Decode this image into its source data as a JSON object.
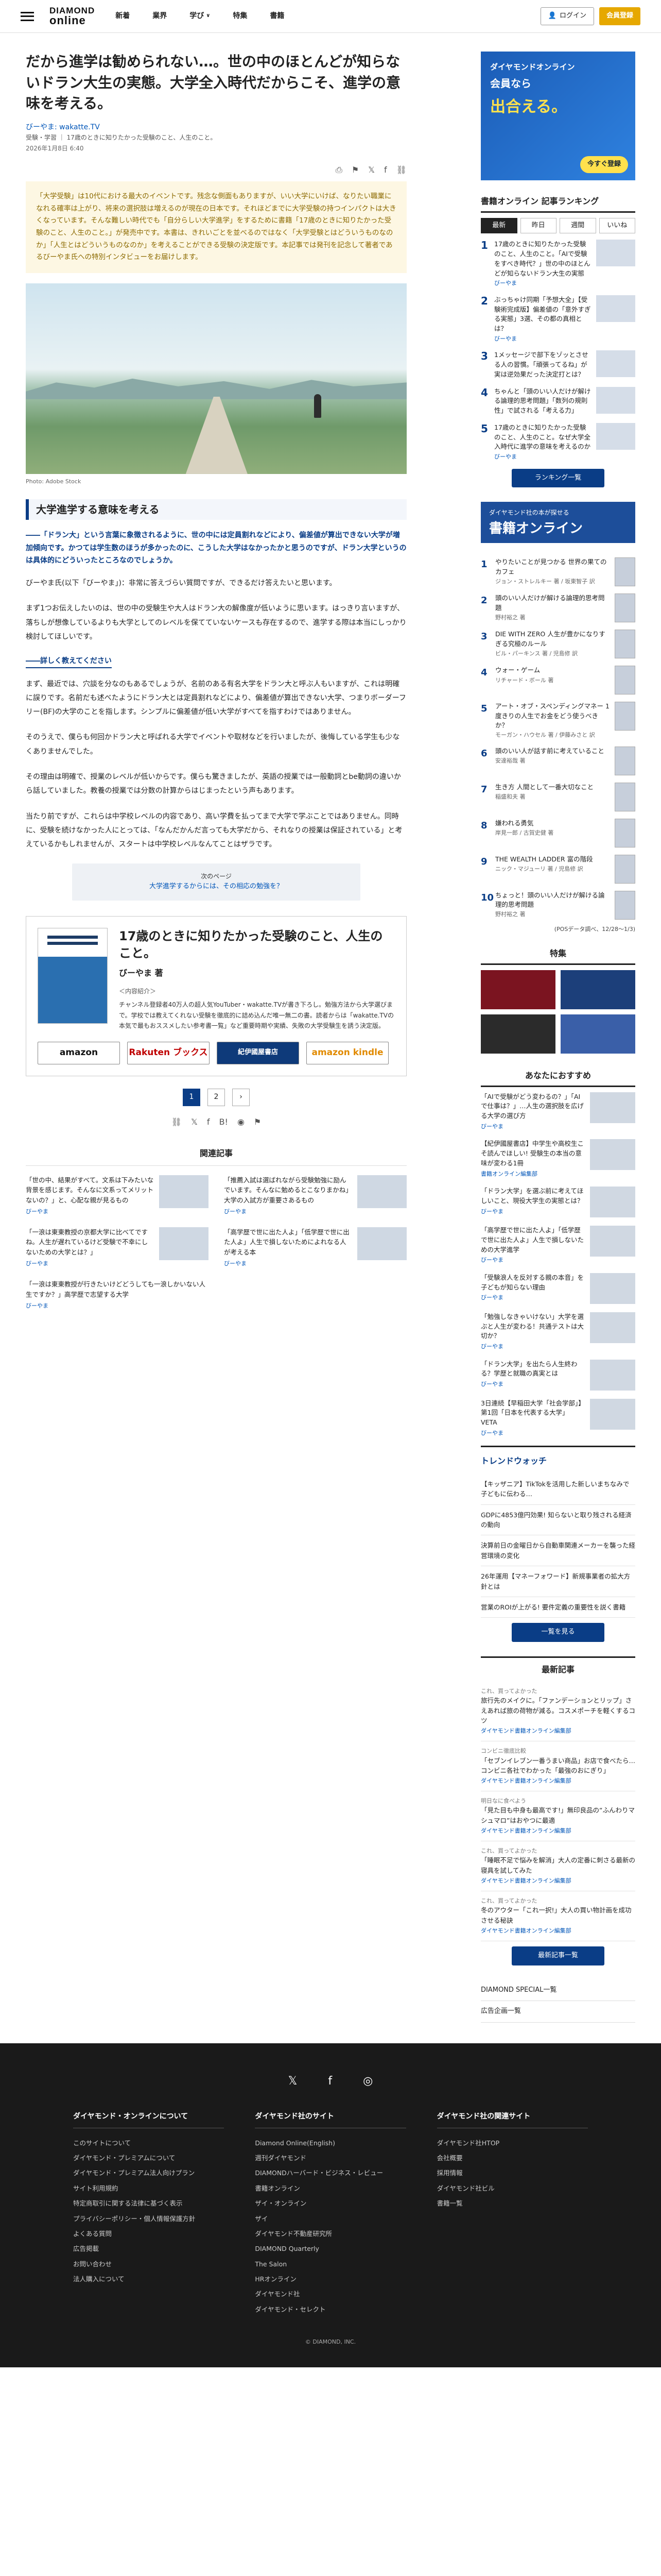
{
  "header": {
    "logo_top": "DIAMOND",
    "logo_bottom": "online",
    "nav": [
      "新着",
      "業界",
      "学び",
      "特集",
      "書籍"
    ],
    "nav_dropdown_marker": "∨",
    "login": "ログイン",
    "member": "会員登録"
  },
  "article": {
    "title": "だから進学は勧められない…。世の中のほとんどが知らないドラン大生の実態。大学全入時代だからこそ、進学の意味を考える。",
    "author": "びーやま: wakatte.TV",
    "breadcrumbs": "受験・学習 ｜ 17歳のときに知りたかった受験のこと、人生のこと。",
    "date": "2026年1月8日 6:40",
    "share_icons": [
      "print-icon",
      "bookmark-icon",
      "x-icon",
      "facebook-icon",
      "link-icon"
    ],
    "lead": "「大学受験」は10代における最大のイベントです。残念な側面もありますが、いい大学にいけば、なりたい職業になれる確率は上がり、将来の選択肢は増えるのが現在の日本です。それほどまでに大学受験の持つインパクトは大きくなっています。そんな難しい時代でも「自分らしい大学進学」をするために書籍「17歳のときに知りたかった受験のこと、人生のこと。」が発売中です。本書は、きれいごとを並べるのではなく「大学受験とはどういうものなのか」「人生とはどういうものなのか」を考えることができる受験の決定版です。本記事では発刊を記念して著者であるびーやま氏への特別インタビューをお届けします。",
    "photo_credit": "Photo: Adobe Stock",
    "section_heading": "大学進学する意味を考える",
    "question": "――「ドラン大」という言葉に象徴されるように、世の中には定員割れなどにより、偏差値が算出できない大学が増加傾向です。かつては学生数のほうが多かったのに、こうした大学はなかったかと思うのですが、ドラン大学というのは具体的にどういったところなのでしょうか。",
    "paragraphs": [
      "びーやま氏(以下「びーやま」)：非常に答えづらい質問ですが、できるだけ答えたいと思います。",
      "まず1つお伝えしたいのは、世の中の受験生や大人はドラン大の解像度が低いように思います。はっきり言いますが、落ちしが想像しているよりも大学としてのレベルを保てていないケースも存在するので、進学する際は本当にしっかり検討してほしいです。",
      "まず、最近では、穴談を分なのもあるでしょうが、名前のある有名大学をドラン大と呼ぶ人もいますが、これは明確に誤りです。名前だも述べたようにドラン大とは定員割れなどにより、偏差値が算出できない大学、つまりボーダーフリー(BF)の大学のことを指します。シンプルに偏差値が低い大学がすべてを指すわけではありません。",
      "そのうえで、僕らも何回かドラン大と呼ばれる大学でイベントや取材などを行いましたが、後悔している学生も少なくありませんでした。",
      "その理由は明確で、授業のレベルが低いからです。僕らも驚きましたが、英語の授業では一般動詞とbe動詞の違いから話していました。教養の授業では分数の計算からはじまったという声もあります。",
      "当たり前ですが、これらは中学校レベルの内容であり、高い学費を払ってまで大学で学ぶことではありません。同時に、受験を続けなかった人にとっては、「なんだかんだ言っても大学だから、それなりの授業は保証されている」と考えているかもしれませんが、スタートは中学校レベルなんてことはザラです。"
    ],
    "subheading": "――詳しく教えてください",
    "next_page_small": "次のページ",
    "next_page_title": "大学進学するからには、その相応の勉強を？",
    "book": {
      "title": "17歳のときに知りたかった受験のこと、人生のこと。",
      "author": "びーやま 著",
      "label": "＜内容紹介＞",
      "desc": "チャンネル登録者40万人の超人気YouTuber・wakatte.TVが書き下ろし。勉強方法から大学選びまで。学校では教えてくれない受験を徹底的に詰め込んだ唯一無二の書。読者からは「wakatte.TVの本気で最もおススメしたい参考書一覧」など重要時期や実績、失敗の大学受験生を誘う決定版。",
      "stores": [
        "amazon",
        "Rakuten ブックス",
        "紀伊國屋書店",
        "amazon kindle"
      ]
    },
    "pager": [
      "1",
      "2",
      "›"
    ],
    "share2": [
      "link-icon",
      "x-icon",
      "facebook-icon",
      "hatena-icon",
      "line-icon",
      "bookmark-icon"
    ]
  },
  "related": {
    "heading": "関連記事",
    "items": [
      {
        "title": "「世の中、結果がすべて。文系は下みたいな背景を感じます。そんなに文系ってメリットないの？」と、心配な親が見るもの",
        "author": "びーやま"
      },
      {
        "title": "「推薦入試は選ばれながら受験勉強に励んでいます。そんなに勉めるとこなりまかね」大学の入試方が重要さあるもの",
        "author": "びーやま"
      },
      {
        "title": "「一浪は東東教授の京都大学に比べてですね。人生が遅れているけど受験で不幸にしないための大学とは？」",
        "author": "びーやま"
      },
      {
        "title": "「高学歴で世に出た人よ」「低学歴で世に出た人よ」人生で損しないためによれなる人が考える本",
        "author": "びーやま"
      },
      {
        "title": "「一浪は東東教授が行きたいけどどうしても一浪しかいない人生ですか？」高学歴で志望する大学",
        "author": "びーやま"
      }
    ]
  },
  "sidebar": {
    "ad_top": {
      "l1": "ダイヤモンドオンライン",
      "l2": "会員なら",
      "l3": "出合える。",
      "btn": "今すぐ登録"
    },
    "ranking": {
      "heading": "書籍オンライン 記事ランキング",
      "tabs": [
        "最新",
        "昨日",
        "週間",
        "いいね"
      ],
      "items": [
        {
          "no": "1",
          "title": "17歳のときに知りたかった受験のこと、人生のこと。「AIで受験をすべき時代？」世の中のほとんどが知らないドラン大生の実態",
          "author": "びーやま"
        },
        {
          "no": "2",
          "title": "ぶっちゃけ同期「予想大全」【受験術完成版】偏差値の「意外すぎる実態」3選、その都の真相とは？",
          "author": "びーやま"
        },
        {
          "no": "3",
          "title": "1メッセージで部下をゾッとさせる人の習慣。「頑張ってるね」が実は逆効果だった決定打とは？",
          "author": ""
        },
        {
          "no": "4",
          "title": "ちゃんと「頭のいい人だけが解ける論理的思考問題」「数列の規則性」で試される「考える力」",
          "author": ""
        },
        {
          "no": "5",
          "title": "17歳のときに知りたかった受験のこと、人生のこと。なぜ大学全入時代に進学の意味を考えるのか",
          "author": "びーやま"
        }
      ],
      "more": "ランキング一覧"
    },
    "ad_mid": {
      "l1": "ダイヤモンド社の本が探せる",
      "l2": "書籍オンライン"
    },
    "book_ranking": {
      "items": [
        {
          "no": "1",
          "title": "やりたいことが見つかる 世界の果てのカフェ",
          "author": "ジョン・ストレルキー 著 / 坂東智子 訳"
        },
        {
          "no": "2",
          "title": "頭のいい人だけが解ける論理的思考問題",
          "author": "野村裕之 著"
        },
        {
          "no": "3",
          "title": "DIE WITH ZERO 人生が豊かになりすぎる究極のルール",
          "author": "ビル・パーキンス 著 / 児島修 訳"
        },
        {
          "no": "4",
          "title": "ウォー・ゲーム",
          "author": "リチャード・ボール 著"
        },
        {
          "no": "5",
          "title": "アート・オブ・スペンディングマネー 1度きりの人生でお金をどう使うべきか？",
          "author": "モーガン・ハウセル 著 / 伊藤みさと 訳"
        },
        {
          "no": "6",
          "title": "頭のいい人が話す前に考えていること",
          "author": "安達裕哉 著"
        },
        {
          "no": "7",
          "title": "生き方 人間として一番大切なこと",
          "author": "稲盛和夫 著"
        },
        {
          "no": "8",
          "title": "嫌われる勇気",
          "author": "岸見一郎 / 古賀史健 著"
        },
        {
          "no": "9",
          "title": "THE WEALTH LADDER 富の階段",
          "author": "ニック・マジューリ 著 / 児島修 訳"
        },
        {
          "no": "10",
          "title": "ちょっと！頭のいい人だけが解ける論理的思考問題",
          "author": "野村裕之 著"
        }
      ],
      "note": "(POSデータ調べ、12/28～1/3)"
    },
    "feature_heading": "特集",
    "recommend_heading": "あなたにおすすめ",
    "recommend": [
      {
        "title": "「AIで受験がどう変わるの？」「AIで仕事は？」…人生の選択肢を広げる大学の選び方",
        "author": "びーやま"
      },
      {
        "title": "【紀伊國屋書店】中学生や高校生こそ読んでほしい! 受験生の本当の意味が変わる1冊",
        "author": "書籍オンライン編集部"
      },
      {
        "title": "「ドラン大学」を選ぶ前に考えてほしいこと、現役大学生の実態とは？",
        "author": "びーやま"
      },
      {
        "title": "「高学歴で世に出た人よ」「低学歴で世に出た人よ」人生で損しないための大学進学",
        "author": "びーやま"
      },
      {
        "title": "「受験浪人を反対する親の本音」を子どもが知らない理由",
        "author": "びーやま"
      },
      {
        "title": "「勉強しなきゃいけない」大学を選ぶと人生が変わる！共通テストは大切か？",
        "author": "びーやま"
      },
      {
        "title": "「ドラン大学」を出たら人生終わる？学歴と就職の真実とは",
        "author": "びーやま"
      },
      {
        "title": "3日連続【早稲田大学「社会学部」】第1回「日本を代表する大学」VETA",
        "author": "びーやま"
      }
    ],
    "trend": {
      "logo": "トレンドウォッチ",
      "items": [
        "【キッザニア】TikTokを活用した新しいまちなみで子どもに伝わる…",
        "GDPに4853億円効果! 知らないと取り残される経済の動向",
        "決算前日の金曜日から自動車関連メーカーを襲った経営環境の変化",
        "26年運用【マネーフォワード】新規事業者の拡大方針とは",
        "営業のROIが上がる! 要件定義の重要性を説く書籍"
      ],
      "more": "一覧を見る"
    },
    "latest_heading": "最新記事",
    "latest": [
      {
        "cat": "これ、買ってよかった",
        "title": "旅行先のメイクに。「ファンデーションとリップ」さえあれば旅の荷物が減る。コスメポーチを軽くするコツ",
        "author": "ダイヤモンド書籍オンライン編集部"
      },
      {
        "cat": "コンビニ徹底比較",
        "title": "「セブンイレブン一番うまい商品」お店で食べたら…コンビニ各社でわかった「最強のおにぎり」",
        "author": "ダイヤモンド書籍オンライン編集部"
      },
      {
        "cat": "明日なに食べよう",
        "title": "「見た目も中身も最高です!」無印良品の“ふんわりマシュマロ”はおやつに最適",
        "author": "ダイヤモンド書籍オンライン編集部"
      },
      {
        "cat": "これ、買ってよかった",
        "title": "「睡眠不足で悩みを解消」大人の定番に刺さる最新の寝具を試してみた",
        "author": "ダイヤモンド書籍オンライン編集部"
      },
      {
        "cat": "これ、買ってよかった",
        "title": "冬のアウター「これ一択!」大人の買い物計画を成功させる秘訣",
        "author": "ダイヤモンド書籍オンライン編集部"
      }
    ],
    "latest_more": "最新記事一覧",
    "links": [
      "DIAMOND SPECIAL一覧",
      "広告企画一覧"
    ]
  },
  "footer": {
    "social": [
      "x-icon",
      "facebook-icon",
      "rss-icon"
    ],
    "cols": [
      {
        "heading": "ダイヤモンド・オンラインについて",
        "links": [
          "このサイトについて",
          "ダイヤモンド・プレミアムについて",
          "ダイヤモンド・プレミアム法人向けプラン",
          "サイト利用規約",
          "特定商取引に関する法律に基づく表示",
          "プライバシーポリシー・個人情報保護方針",
          "よくある質問",
          "広告掲載",
          "お問い合わせ",
          "法人購入について"
        ]
      },
      {
        "heading": "ダイヤモンド社のサイト",
        "links": [
          "Diamond Online(English)",
          "週刊ダイヤモンド",
          "DIAMONDハーバード・ビジネス・レビュー",
          "書籍オンライン",
          "ザイ・オンライン",
          "ザイ",
          "ダイヤモンド不動産研究所",
          "DIAMOND Quarterly",
          "The Salon",
          "HRオンライン",
          "ダイヤモンド社",
          "ダイヤモンド・セレクト"
        ]
      },
      {
        "heading": "ダイヤモンド社の関連サイト",
        "links": [
          "ダイヤモンド社HTOP",
          "会社概要",
          "採用情報",
          "ダイヤモンド社ビル",
          "書籍一覧"
        ]
      }
    ],
    "copyright": "© DIAMOND, INC."
  }
}
